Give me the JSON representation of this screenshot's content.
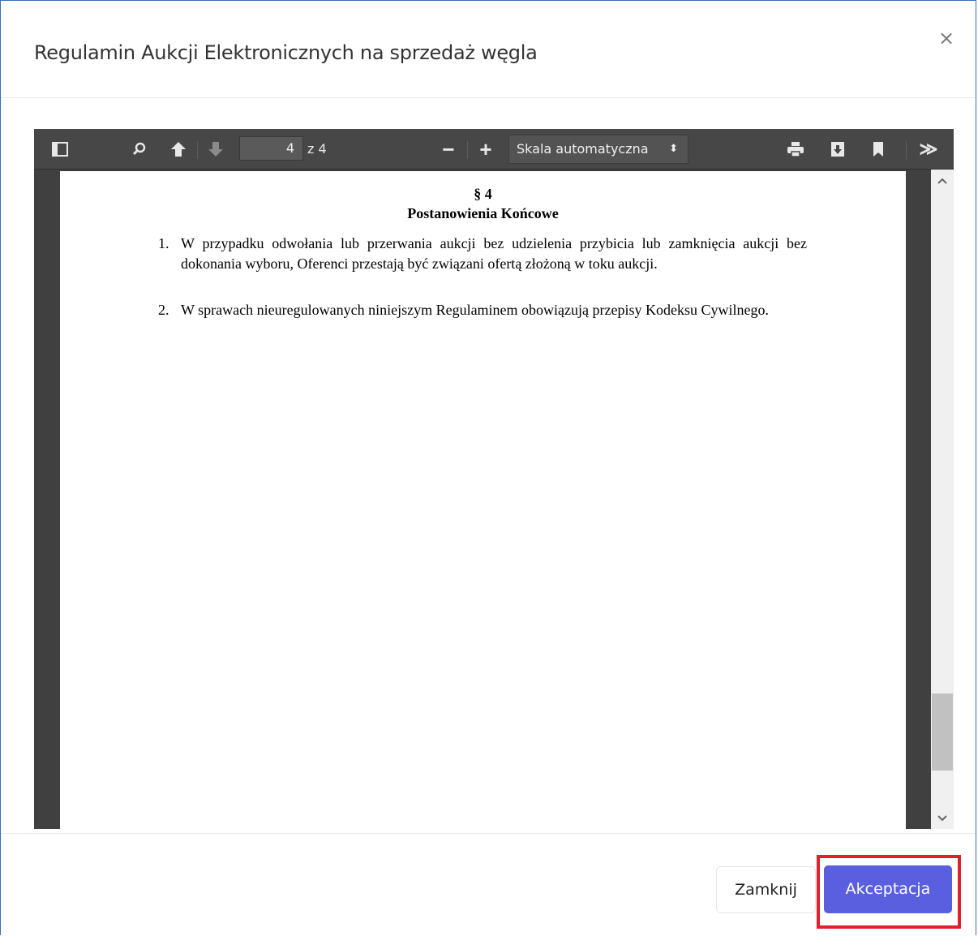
{
  "modal": {
    "title": "Regulamin Aukcji Elektronicznych na sprzedaż węgla",
    "close_symbol": "×"
  },
  "viewer_toolbar": {
    "icons": [
      "sidebar-toggle-icon",
      "search-icon",
      "previous-page-icon",
      "next-page-icon",
      "zoom-out-icon",
      "zoom-in-icon",
      "print-icon",
      "download-icon",
      "bookmark-icon",
      "tools-icon"
    ],
    "page_number": "4",
    "page_count": "z 4",
    "zoom_out_symbol": "−",
    "zoom_in_symbol": "+",
    "scale_value": "Skala automatyczna",
    "more_symbol": "≫"
  },
  "document": {
    "section_number": "§ 4",
    "section_title": "Postanowienia Końcowe",
    "items": [
      {
        "number": "1.",
        "text": "W przypadku odwołania lub przerwania aukcji bez udzielenia przybicia lub zamknięcia aukcji bez dokonania wyboru, Oferenci przestają być związani ofertą złożoną w toku aukcji."
      },
      {
        "number": "2.",
        "text": "W sprawach nieuregulowanych niniejszym Regulaminem obowiązują przepisy Kodeksu Cywilnego."
      }
    ]
  },
  "scrollbar": {
    "up_symbol": "⌃",
    "down_symbol": "⌄"
  },
  "footer": {
    "close_label": "Zamknij",
    "accept_label": "Akceptacja"
  },
  "colors": {
    "accent": "#5a5fe0",
    "highlight": "#e0212b",
    "toolbar": "#474747"
  }
}
